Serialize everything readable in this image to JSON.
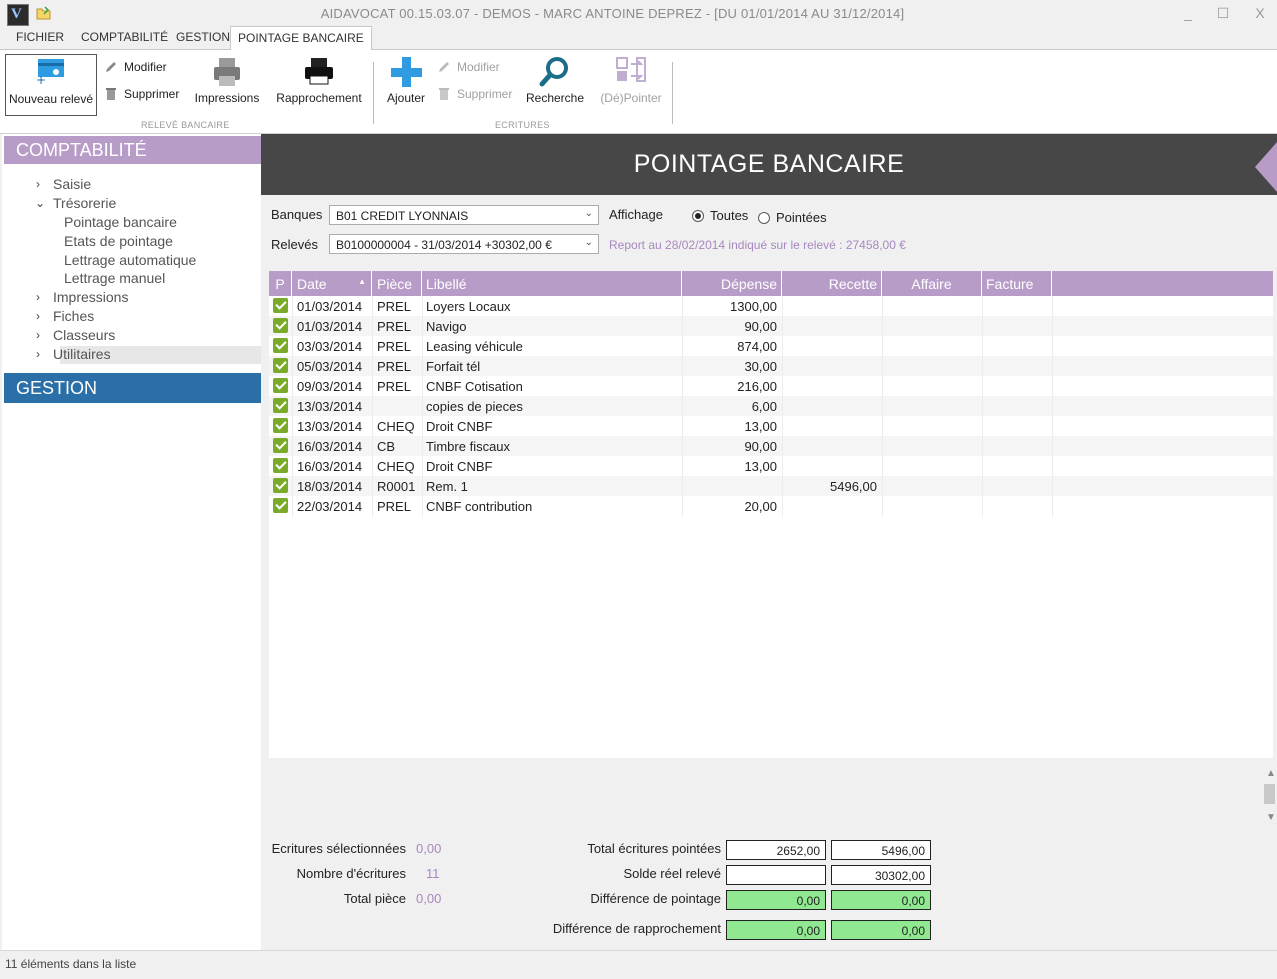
{
  "window": {
    "title": "AIDAVOCAT 00.15.03.07 - DEMOS - MARC ANTOINE DEPREZ - [DU 01/01/2014 AU 31/12/2014]",
    "minimize": "_",
    "maximize": "☐",
    "close": "X"
  },
  "ribbon_tabs": [
    "FICHIER",
    "COMPTABILITÉ",
    "GESTION",
    "POINTAGE BANCAIRE"
  ],
  "ribbon": {
    "nouveau_releve": "Nouveau relevé",
    "modifier": "Modifier",
    "supprimer": "Supprimer",
    "impressions": "Impressions",
    "rapprochement": "Rapprochement",
    "group_releve": "RELEVÉ BANCAIRE",
    "ajouter": "Ajouter",
    "modifier2": "Modifier",
    "supprimer2": "Supprimer",
    "recherche": "Recherche",
    "depointer": "(Dé)Pointer",
    "group_ecritures": "ECRITURES"
  },
  "nav": {
    "comptabilite": "COMPTABILITÉ",
    "saisie": "Saisie",
    "tresorerie": "Trésorerie",
    "pointage_bancaire": "Pointage bancaire",
    "etats_pointage": "Etats de pointage",
    "lettrage_auto": "Lettrage automatique",
    "lettrage_manuel": "Lettrage manuel",
    "impressions": "Impressions",
    "fiches": "Fiches",
    "classeurs": "Classeurs",
    "utilitaires": "Utilitaires",
    "gestion": "GESTION"
  },
  "page_title": "POINTAGE BANCAIRE",
  "filters": {
    "banques_label": "Banques",
    "banques_value": "B01 CREDIT LYONNAIS",
    "releves_label": "Relevés",
    "releves_value": "B0100000004 - 31/03/2014  +30302,00 €",
    "affichage_label": "Affichage",
    "toutes": "Toutes",
    "pointees": "Pointées",
    "report": "Report au 28/02/2014 indiqué sur le relevé : 27458,00 €"
  },
  "table": {
    "headers": [
      "P",
      "Date",
      "Pièce",
      "Libellé",
      "Dépense",
      "Recette",
      "Affaire",
      "Facture"
    ],
    "rows": [
      {
        "date": "01/03/2014",
        "piece": "PREL",
        "libelle": "Loyers Locaux",
        "depense": "1300,00",
        "recette": ""
      },
      {
        "date": "01/03/2014",
        "piece": "PREL",
        "libelle": "Navigo",
        "depense": "90,00",
        "recette": ""
      },
      {
        "date": "03/03/2014",
        "piece": "PREL",
        "libelle": "Leasing véhicule",
        "depense": "874,00",
        "recette": ""
      },
      {
        "date": "05/03/2014",
        "piece": "PREL",
        "libelle": "Forfait tél",
        "depense": "30,00",
        "recette": ""
      },
      {
        "date": "09/03/2014",
        "piece": "PREL",
        "libelle": "CNBF Cotisation",
        "depense": "216,00",
        "recette": ""
      },
      {
        "date": "13/03/2014",
        "piece": "",
        "libelle": "copies de pieces",
        "depense": "6,00",
        "recette": ""
      },
      {
        "date": "13/03/2014",
        "piece": "CHEQ",
        "libelle": "Droit CNBF",
        "depense": "13,00",
        "recette": ""
      },
      {
        "date": "16/03/2014",
        "piece": "CB",
        "libelle": "Timbre fiscaux",
        "depense": "90,00",
        "recette": ""
      },
      {
        "date": "16/03/2014",
        "piece": "CHEQ",
        "libelle": "Droit CNBF",
        "depense": "13,00",
        "recette": ""
      },
      {
        "date": "18/03/2014",
        "piece": "R0001",
        "libelle": "Rem. 1",
        "depense": "",
        "recette": "5496,00"
      },
      {
        "date": "22/03/2014",
        "piece": "PREL",
        "libelle": "CNBF contribution",
        "depense": "20,00",
        "recette": ""
      }
    ]
  },
  "footer": {
    "ecritures_sel_label": "Ecritures sélectionnées",
    "ecritures_sel_value": "0,00",
    "nb_ecritures_label": "Nombre d'écritures",
    "nb_ecritures_value": "11",
    "total_piece_label": "Total pièce",
    "total_piece_value": "0,00",
    "total_pointees_label": "Total écritures pointées",
    "total_pointees_dep": "2652,00",
    "total_pointees_rec": "5496,00",
    "solde_label": "Solde réel relevé",
    "solde_dep": "",
    "solde_rec": "30302,00",
    "diff_pointage_label": "Différence de pointage",
    "diff_pointage_dep": "0,00",
    "diff_pointage_rec": "0,00",
    "diff_rappro_label": "Différence de rapprochement",
    "diff_rappro_dep": "0,00",
    "diff_rappro_rec": "0,00"
  },
  "status": "11 éléments dans la liste",
  "colors": {
    "accent_purple": "#b89cc8",
    "header_dark": "#474747",
    "gestion_blue": "#2a6fa8",
    "check_green": "#7aaa2a",
    "diff_green": "#90e890"
  }
}
